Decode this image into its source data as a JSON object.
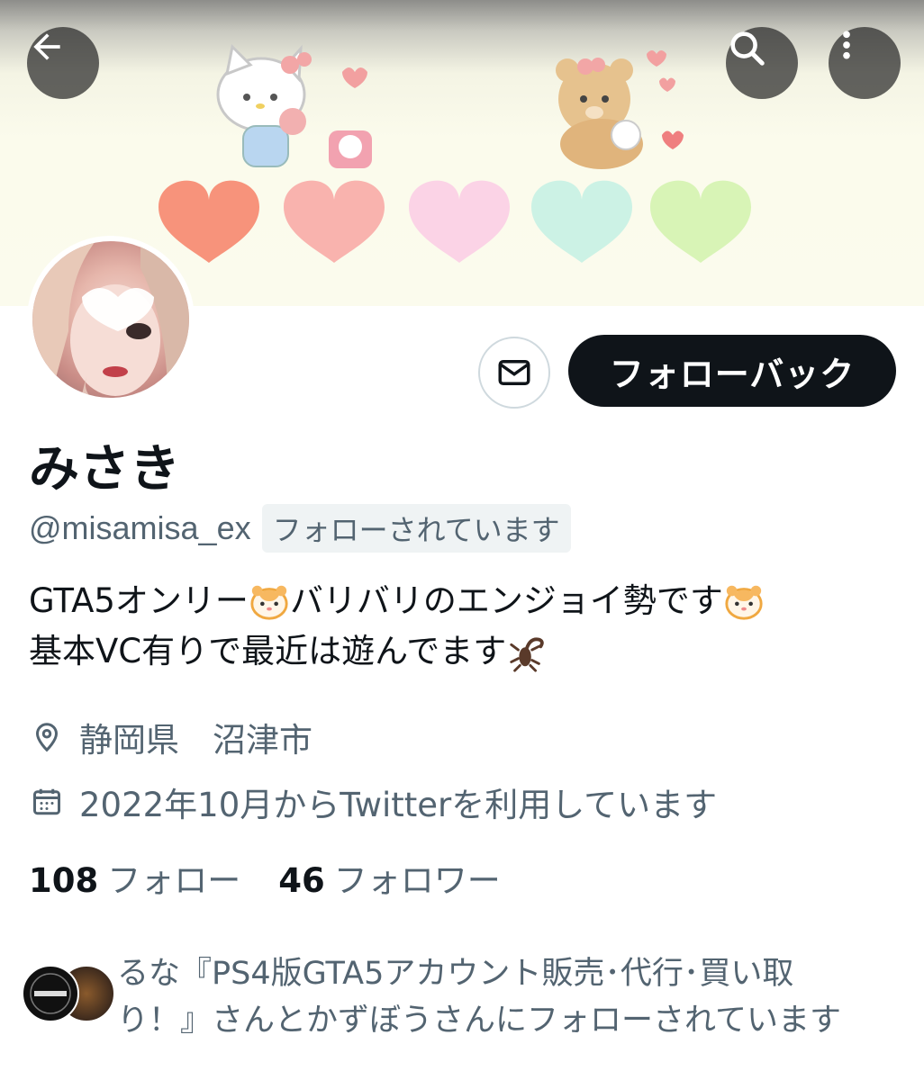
{
  "header": {
    "back_icon": "arrow-left-icon",
    "search_icon": "search-icon",
    "more_icon": "more-vertical-icon"
  },
  "profile": {
    "display_name": "みさき",
    "handle": "@misamisa_ex",
    "follows_you_badge": "フォローされています",
    "follow_back_label": "フォローバック",
    "message_icon": "mail-icon"
  },
  "bio": {
    "line1_part1": "GTA5オンリー",
    "line1_part2": "バリバリのエンジョイ勢です",
    "line2_part1": "基本VC有りで最近は遊んでます",
    "emoji1": "hamster-face-emoji",
    "emoji2": "scorpion-emoji"
  },
  "meta": {
    "location": "静岡県　沼津市",
    "joined": "2022年10月からTwitterを利用しています",
    "location_icon": "location-pin-icon",
    "calendar_icon": "calendar-icon"
  },
  "stats": {
    "following_count": "108",
    "following_label": "フォロー",
    "followers_count": "46",
    "followers_label": "フォロワー"
  },
  "followed_by": {
    "line1": "るな『PS4版GTA5アカウント販売･代行･買い取",
    "line2": "り！』さんとかずぼうさんにフォローされています"
  },
  "colors": {
    "primary_text": "#0f1419",
    "secondary_text": "#536471",
    "follow_button_bg": "#0f1419",
    "badge_bg": "#eff3f4",
    "heart_colors": [
      "#f7937b",
      "#f9b3ae",
      "#fbd3e6",
      "#ccf2e5",
      "#d8f4b6"
    ]
  }
}
